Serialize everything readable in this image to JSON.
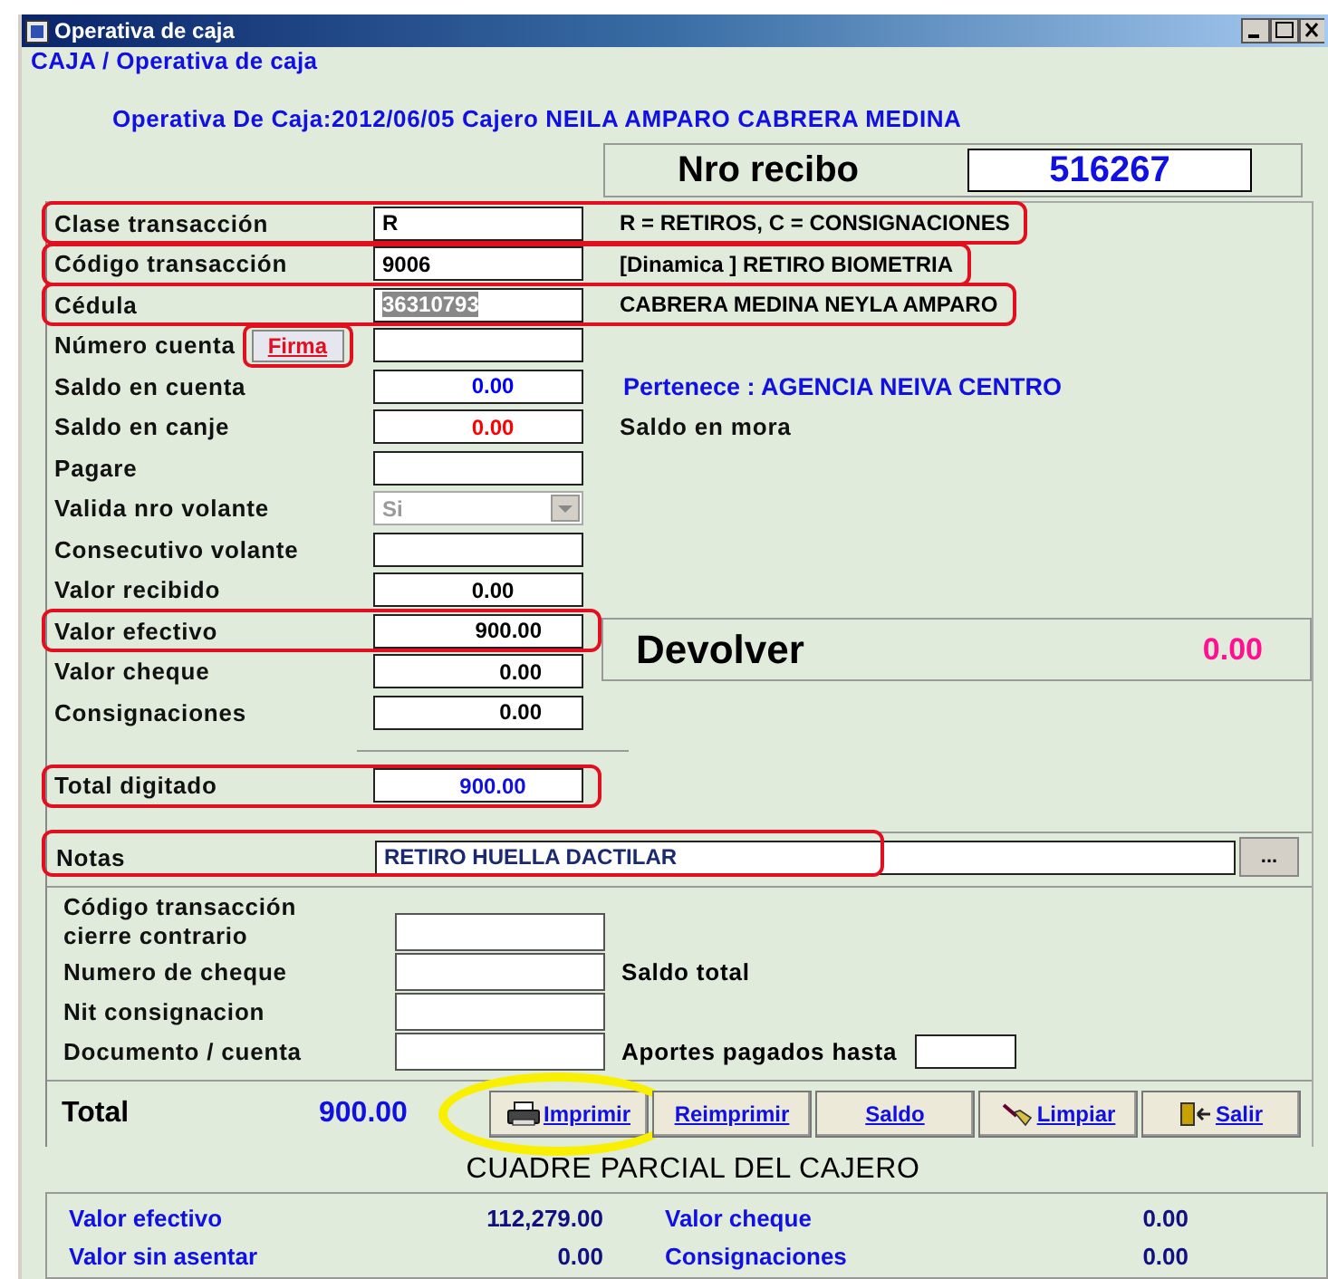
{
  "window": {
    "title": "Operativa de caja"
  },
  "breadcrumb": "CAJA / Operativa de caja",
  "header": "Operativa De Caja:2012/06/05 Cajero NEILA AMPARO CABRERA MEDINA",
  "receipt": {
    "label": "Nro recibo",
    "value": "516267"
  },
  "fields": [
    {
      "label": "Clase transacción",
      "kind": "text",
      "value": "R",
      "marked": true,
      "text_selected": false,
      "note": {
        "text": "R = RETIROS, C = CONSIGNACIONES",
        "kind": "plain"
      }
    },
    {
      "label": "Código transacción",
      "kind": "text",
      "value": "9006",
      "marked": true,
      "text_selected": false,
      "note": {
        "text": "[Dinamica ] RETIRO BIOMETRIA",
        "kind": "plain"
      }
    },
    {
      "label": "Cédula",
      "kind": "text",
      "value": "36310793",
      "marked": true,
      "text_selected": true,
      "note": {
        "text": "CABRERA MEDINA NEYLA AMPARO",
        "kind": "plain"
      }
    },
    {
      "label": "Número cuenta",
      "kind": "text",
      "button": "Firma",
      "marked": false,
      "button_marked": true
    },
    {
      "label": "Saldo en cuenta",
      "kind": "balance",
      "value": "0.00",
      "marked": false,
      "text_selected": false,
      "note": {
        "text": "Pertenece : AGENCIA NEIVA CENTRO",
        "kind": "info"
      }
    },
    {
      "label": "Saldo en canje",
      "kind": "alert",
      "value": "0.00",
      "marked": false,
      "text_selected": false,
      "note": {
        "text": "Saldo en mora",
        "kind": "label"
      }
    },
    {
      "label": "Pagare",
      "kind": "text",
      "marked": false
    },
    {
      "label": "Valida nro volante",
      "kind": "select",
      "value": "Si",
      "disabled": true,
      "marked": false
    },
    {
      "label": "Consecutivo volante",
      "kind": "text",
      "marked": false
    },
    {
      "label": "Valor recibido",
      "kind": "amount",
      "value": "0.00",
      "marked": false,
      "text_selected": false
    }
  ],
  "amounts": [
    {
      "label": "Valor efectivo",
      "value": "900.00",
      "marked": true
    },
    {
      "label": "Valor cheque",
      "value": "0.00",
      "marked": false
    },
    {
      "label": "Consignaciones",
      "value": "0.00",
      "marked": false
    }
  ],
  "change": {
    "label": "Devolver",
    "value": "0.00"
  },
  "total_typed": {
    "label": "Total digitado",
    "value": "900.00",
    "marked": true
  },
  "notes": {
    "label": "Notas",
    "value": "RETIRO HUELLA DACTILAR",
    "button": "...",
    "marked": true
  },
  "extra_fields": [
    {
      "label": "Código transacción cierre contrario"
    },
    {
      "label": "Numero de cheque",
      "side": "Saldo total"
    },
    {
      "label": "Nit consignacion"
    },
    {
      "label": "Documento / cuenta",
      "side": "Aportes pagados hasta",
      "side_field": true
    }
  ],
  "total": {
    "label": "Total",
    "value": "900.00"
  },
  "buttons": [
    {
      "label": "Imprimir",
      "kind": "printer",
      "circled": true
    },
    {
      "label": "Reimprimir",
      "kind": "plain",
      "circled": false
    },
    {
      "label": "Saldo",
      "kind": "plain",
      "circled": false
    },
    {
      "label": "Limpiar",
      "kind": "broom",
      "circled": false
    },
    {
      "label": "Salir",
      "kind": "exit",
      "circled": false
    }
  ],
  "summary": {
    "title": "CUADRE PARCIAL DEL CAJERO",
    "rows": [
      {
        "label_1": "Valor efectivo",
        "value_1": "112,279.00",
        "label_2": "Valor cheque",
        "value_2": "0.00"
      },
      {
        "label_1": "Valor sin asentar",
        "value_1": "0.00",
        "label_2": "Consignaciones",
        "value_2": "0.00"
      }
    ]
  }
}
